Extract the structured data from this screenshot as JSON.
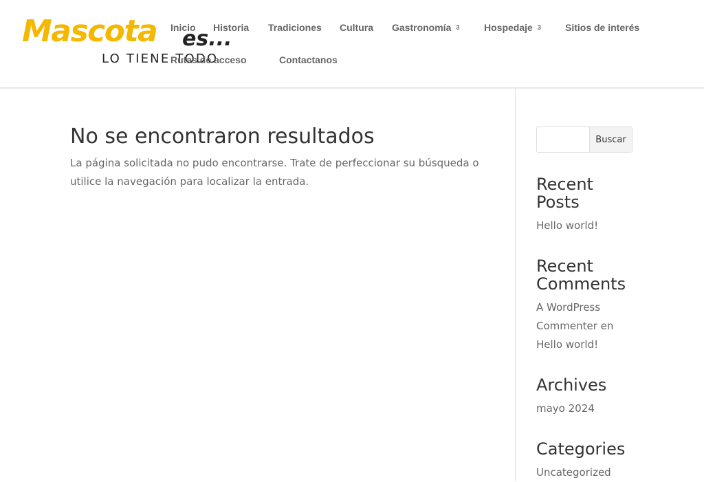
{
  "header": {
    "logo": {
      "main": "Mascota",
      "es": "es...",
      "tagline": "LO TIENE TODO",
      "brand_color": "#f5b800"
    },
    "nav": [
      {
        "label": "Inicio",
        "has_submenu": false
      },
      {
        "label": "Historia",
        "has_submenu": false
      },
      {
        "label": "Tradiciones",
        "has_submenu": false
      },
      {
        "label": "Cultura",
        "has_submenu": false
      },
      {
        "label": "Gastronomía",
        "has_submenu": true,
        "badge": "3"
      },
      {
        "label": "Hospedaje",
        "has_submenu": true,
        "badge": "3"
      },
      {
        "label": "Sitios de interés",
        "has_submenu": false
      },
      {
        "label": "Rutas de acceso",
        "has_submenu": false
      },
      {
        "label": "Contactanos",
        "has_submenu": false
      }
    ]
  },
  "main": {
    "title": "No se encontraron resultados",
    "text": "La página solicitada no pudo encontrarse. Trate de perfeccionar su búsqueda o utilice la navegación para localizar la entrada."
  },
  "sidebar": {
    "search": {
      "value": "",
      "placeholder": "",
      "button_label": "Buscar"
    },
    "recent_posts": {
      "title": "Recent Posts",
      "items": [
        "Hello world!"
      ]
    },
    "recent_comments": {
      "title": "Recent Comments",
      "author": "A WordPress Commenter",
      "connector": "en",
      "post": "Hello world!"
    },
    "archives": {
      "title": "Archives",
      "items": [
        "mayo 2024"
      ]
    },
    "categories": {
      "title": "Categories",
      "items": [
        "Uncategorized"
      ]
    }
  },
  "colors": {
    "text": "#666666",
    "heading": "#333333",
    "accent": "#f5b800"
  }
}
